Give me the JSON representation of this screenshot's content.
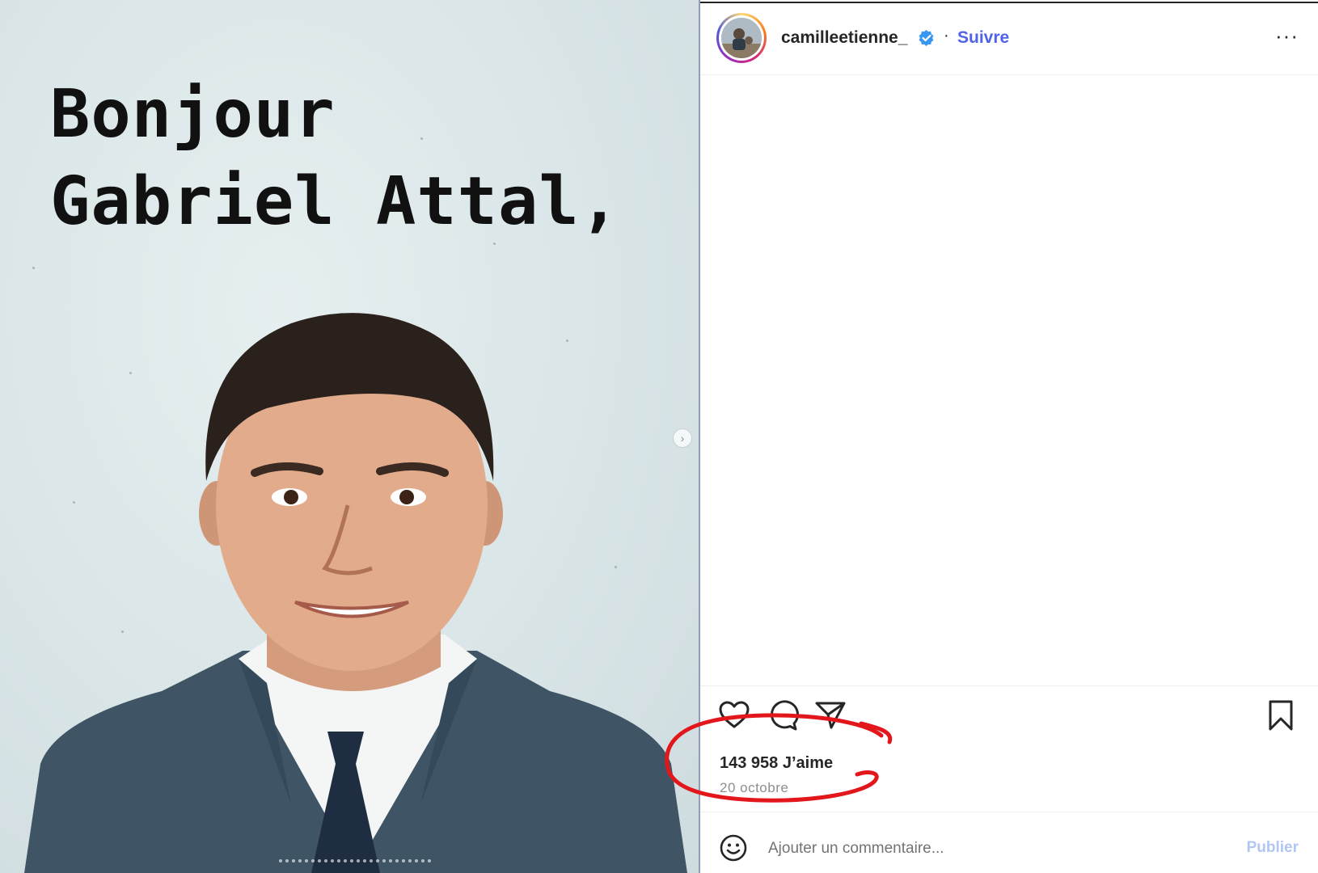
{
  "post_image": {
    "greeting_line1": "Bonjour",
    "greeting_line2": "Gabriel Attal,",
    "bg_color": "#dbe6e8"
  },
  "header": {
    "username": "camilleetienne_",
    "verified": true,
    "separator": "·",
    "follow_label": "Suivre",
    "more_icon": "more-horizontal-icon",
    "more_label": "···"
  },
  "actions": {
    "like_icon": "heart-icon",
    "comment_icon": "comment-icon",
    "share_icon": "send-icon",
    "save_icon": "bookmark-icon"
  },
  "likes": {
    "text": "143 958 J’aime"
  },
  "date": {
    "text": "20 octobre"
  },
  "comment_box": {
    "placeholder": "Ajouter un commentaire...",
    "publish_label": "Publier"
  },
  "colors": {
    "accent": "#4f63e8",
    "publish_disabled": "#b2c6f2",
    "annotation_red": "#e3161b"
  }
}
